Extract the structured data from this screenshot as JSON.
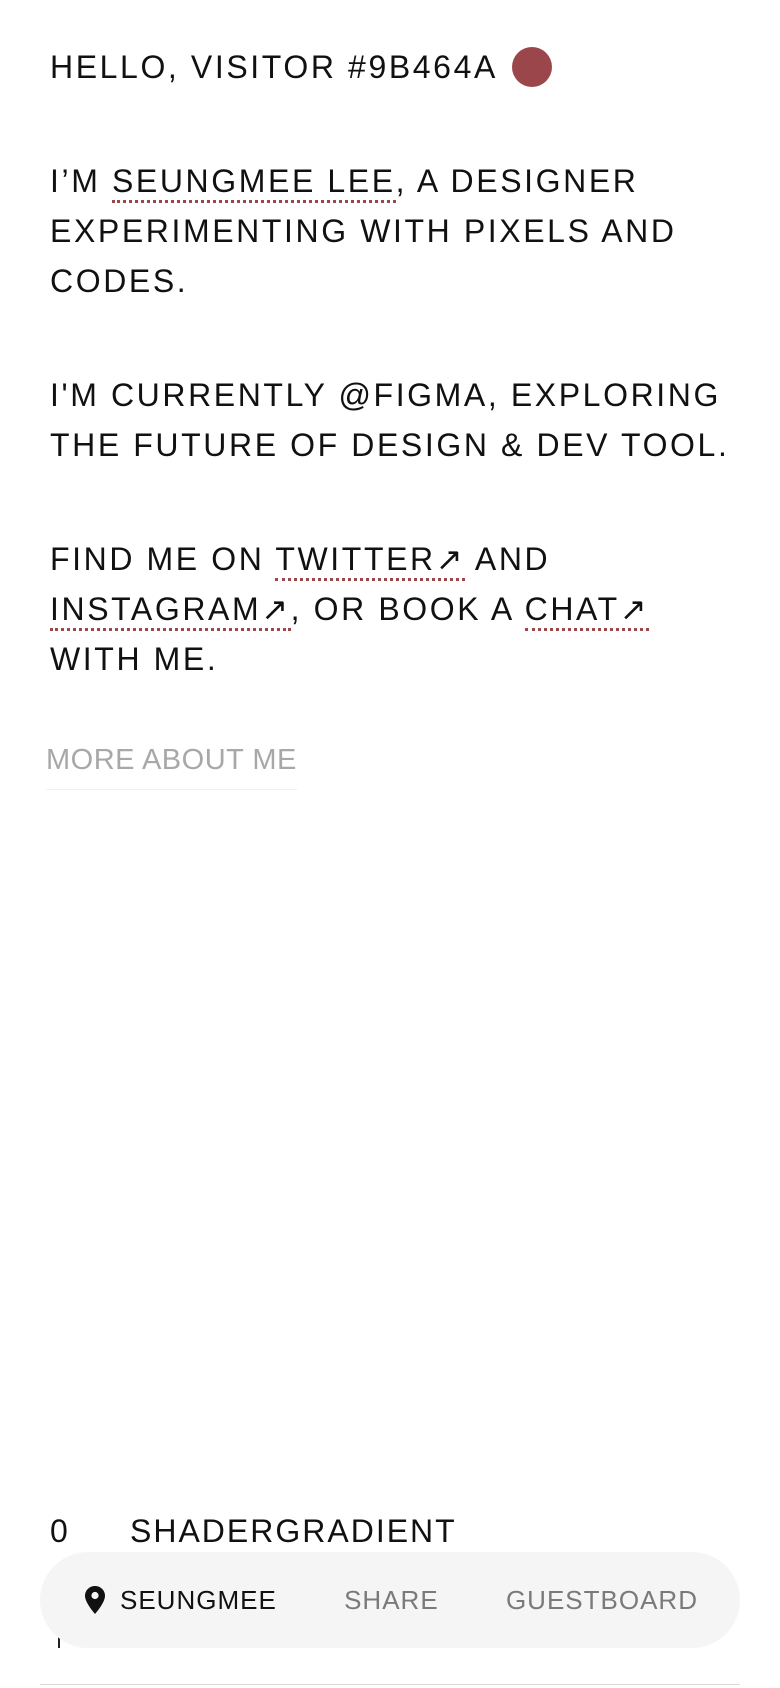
{
  "accent_color": "#9b464a",
  "greeting": "HELLO, VISITOR #9B464A",
  "bio": {
    "prefix": "I’M ",
    "name_link": "SEUNGMEE LEE",
    "suffix": ", A DESIGNER EXPERIMENTING WITH PIXELS AND CODES."
  },
  "current": "I'M CURRENTLY @FIGMA, EXPLORING THE FUTURE OF DESIGN & DEV TOOL.",
  "contact": {
    "t1": "FIND ME ON ",
    "twitter": "TWITTER↗",
    "t2": " AND ",
    "instagram": "INSTAGRAM↗",
    "t3": ", OR BOOK A ",
    "chat": "CHAT↗",
    "t4": " WITH ME."
  },
  "more_link": "MORE ABOUT ME",
  "project": {
    "index": "0",
    "name": "SHADERGRADIENT"
  },
  "nav": {
    "items": [
      {
        "label": "SEUNGMEE",
        "icon": "location-pin-icon",
        "active": true
      },
      {
        "label": "SHARE",
        "active": false
      },
      {
        "label": "GUESTBOARD",
        "active": false
      }
    ]
  }
}
